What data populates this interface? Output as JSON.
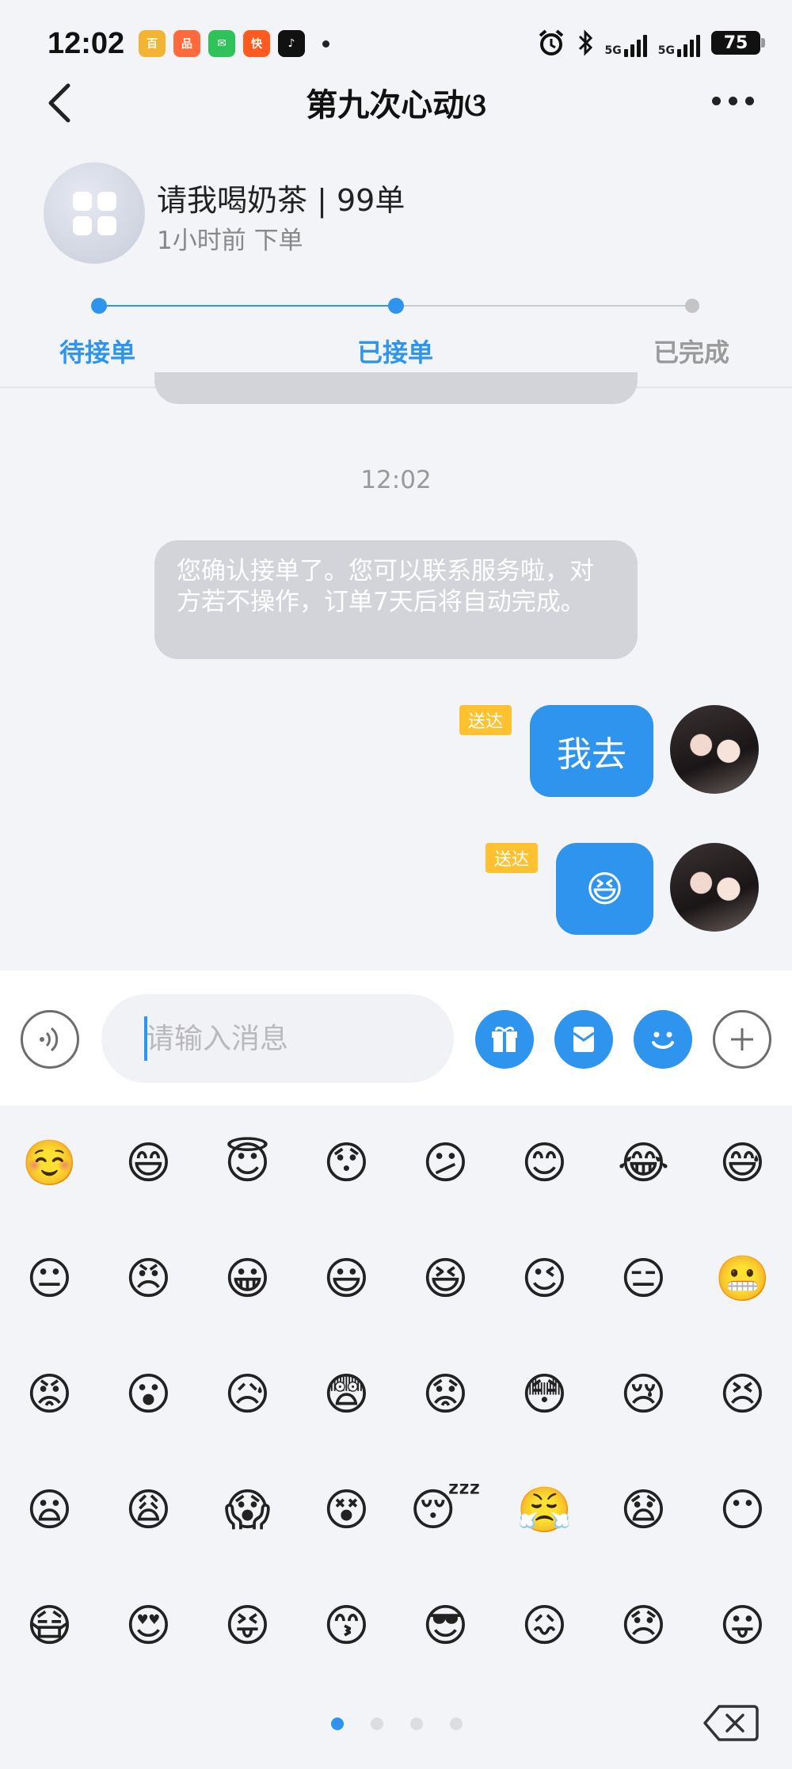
{
  "status_bar": {
    "time": "12:02",
    "app_icons": [
      {
        "name": "news-app-icon",
        "color": "#f3b432",
        "label": "百"
      },
      {
        "name": "shopping-app-icon",
        "color": "#ff6a3d",
        "label": "品"
      },
      {
        "name": "messages-app-icon",
        "color": "#2fc25b",
        "label": "✉"
      },
      {
        "name": "kuaishou-app-icon",
        "color": "#ff5a1f",
        "label": "快"
      },
      {
        "name": "tiktok-app-icon",
        "color": "#111111",
        "label": "♪"
      }
    ],
    "signal1": "5G",
    "signal2": "5G",
    "battery": "75"
  },
  "nav": {
    "title": "第九次心动ଓ"
  },
  "order": {
    "title": "请我喝奶茶 | 99单",
    "subtitle": "1小时前 下单"
  },
  "progress": {
    "steps": [
      {
        "label": "待接单",
        "state": "done"
      },
      {
        "label": "已接单",
        "state": "current"
      },
      {
        "label": "已完成",
        "state": "pending"
      }
    ],
    "active_color": "#2e94ee",
    "pending_color": "#bbbbbb"
  },
  "chat": {
    "timestamp": "12:02",
    "system_message": "您确认接单了。您可以联系服务啦，对方若不操作，订单7天后将自动完成。",
    "messages": [
      {
        "text": "我去",
        "status": "送达"
      },
      {
        "text": "😆",
        "status": "送达"
      }
    ]
  },
  "input": {
    "placeholder": "请输入消息"
  },
  "emoji_panel": {
    "emojis": [
      "☺️",
      "😄",
      "😇",
      "😯",
      "😕",
      "😊",
      "😂",
      "😅",
      "😐",
      "😠",
      "😀",
      "😃",
      "😆",
      "😉",
      "😑",
      "😬",
      "😡",
      "😮",
      "😥",
      "😨",
      "😟",
      "😳",
      "😢",
      "😣",
      "😦",
      "😩",
      "😱",
      "😵",
      "😴",
      "😤",
      "😧",
      "😶",
      "😷",
      "😍",
      "😝",
      "😙",
      "😎",
      "😖",
      "😞",
      "😛"
    ],
    "pages": 4,
    "current_page": 0
  }
}
